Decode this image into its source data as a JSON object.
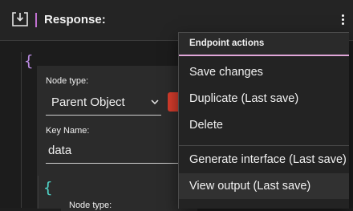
{
  "header": {
    "title": "Response:",
    "icon": "download-icon",
    "menu_icon": "kebab-menu-icon"
  },
  "editor": {
    "open_brace": "{",
    "node_type_label": "Node type:",
    "node_type_value": "Parent Object",
    "key_name_label": "Key Name:",
    "key_name_value": "data",
    "nested_brace": "{",
    "nested_node_type_label": "Node type:"
  },
  "menu": {
    "header": "Endpoint actions",
    "items": [
      {
        "label": "Save changes"
      },
      {
        "label": "Duplicate (Last save)"
      },
      {
        "label": "Delete"
      },
      {
        "label": "Generate interface (Last save)"
      },
      {
        "label": "View output (Last save)"
      }
    ]
  },
  "colors": {
    "accent_pink": "#e0a6d8",
    "danger": "#d43c2c",
    "brace_yellow": "#e8d36b",
    "brace_purple": "#b98ae0",
    "brace_teal": "#4fd1c5"
  }
}
